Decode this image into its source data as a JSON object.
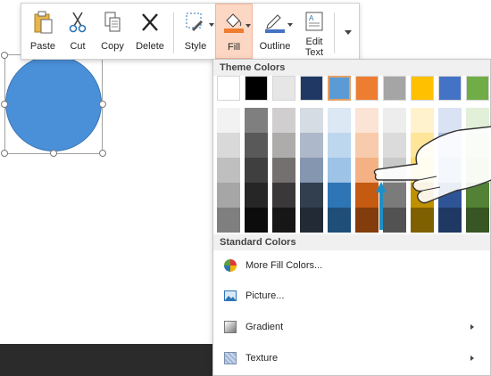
{
  "toolbar": {
    "paste_label": "Paste",
    "cut_label": "Cut",
    "copy_label": "Copy",
    "delete_label": "Delete",
    "style_label": "Style",
    "fill_label": "Fill",
    "outline_label": "Outline",
    "edit_text_label_1": "Edit",
    "edit_text_label_2": "Text"
  },
  "colors": {
    "fill_accent": "#ed7d31",
    "outline_accent": "#4472c4",
    "shape_fill": "#4a90d9",
    "selected_swatch_border": "#e3a067"
  },
  "fill_menu": {
    "theme_colors_header": "Theme Colors",
    "standard_colors_header": "Standard Colors",
    "theme_top_row": [
      "#ffffff",
      "#000000",
      "#e7e6e6",
      "#1f3864",
      "#5b9bd5",
      "#ed7d31",
      "#a5a5a5",
      "#ffc000",
      "#4472c4",
      "#70ad47"
    ],
    "theme_shades": [
      [
        "#f2f2f2",
        "#7f7f7f",
        "#d0cece",
        "#d6dce4",
        "#dde8f5",
        "#fbe4d5",
        "#ededed",
        "#fff2cc",
        "#dae3f3",
        "#e2efd9"
      ],
      [
        "#d9d9d9",
        "#595959",
        "#aeabab",
        "#adb9ca",
        "#bdd7ee",
        "#f7cbac",
        "#dbdbdb",
        "#ffe599",
        "#b4c6e7",
        "#c5e0b3"
      ],
      [
        "#bfbfbf",
        "#3f3f3f",
        "#757070",
        "#8496b0",
        "#9dc3e6",
        "#f4b183",
        "#c9c9c9",
        "#ffd966",
        "#8eaadb",
        "#a8d08d"
      ],
      [
        "#a6a6a6",
        "#262626",
        "#3a3838",
        "#323f4f",
        "#2e75b6",
        "#c55a11",
        "#7b7b7b",
        "#bf9000",
        "#2f5496",
        "#538135"
      ],
      [
        "#7f7f7f",
        "#0c0c0c",
        "#171616",
        "#222a35",
        "#1f4e79",
        "#833c0b",
        "#525252",
        "#7f6000",
        "#1f3864",
        "#375623"
      ]
    ],
    "selected_swatch_index": 4,
    "more_fill_colors_label": "More Fill Colors...",
    "picture_label": "Picture...",
    "gradient_label": "Gradient",
    "texture_label": "Texture"
  }
}
